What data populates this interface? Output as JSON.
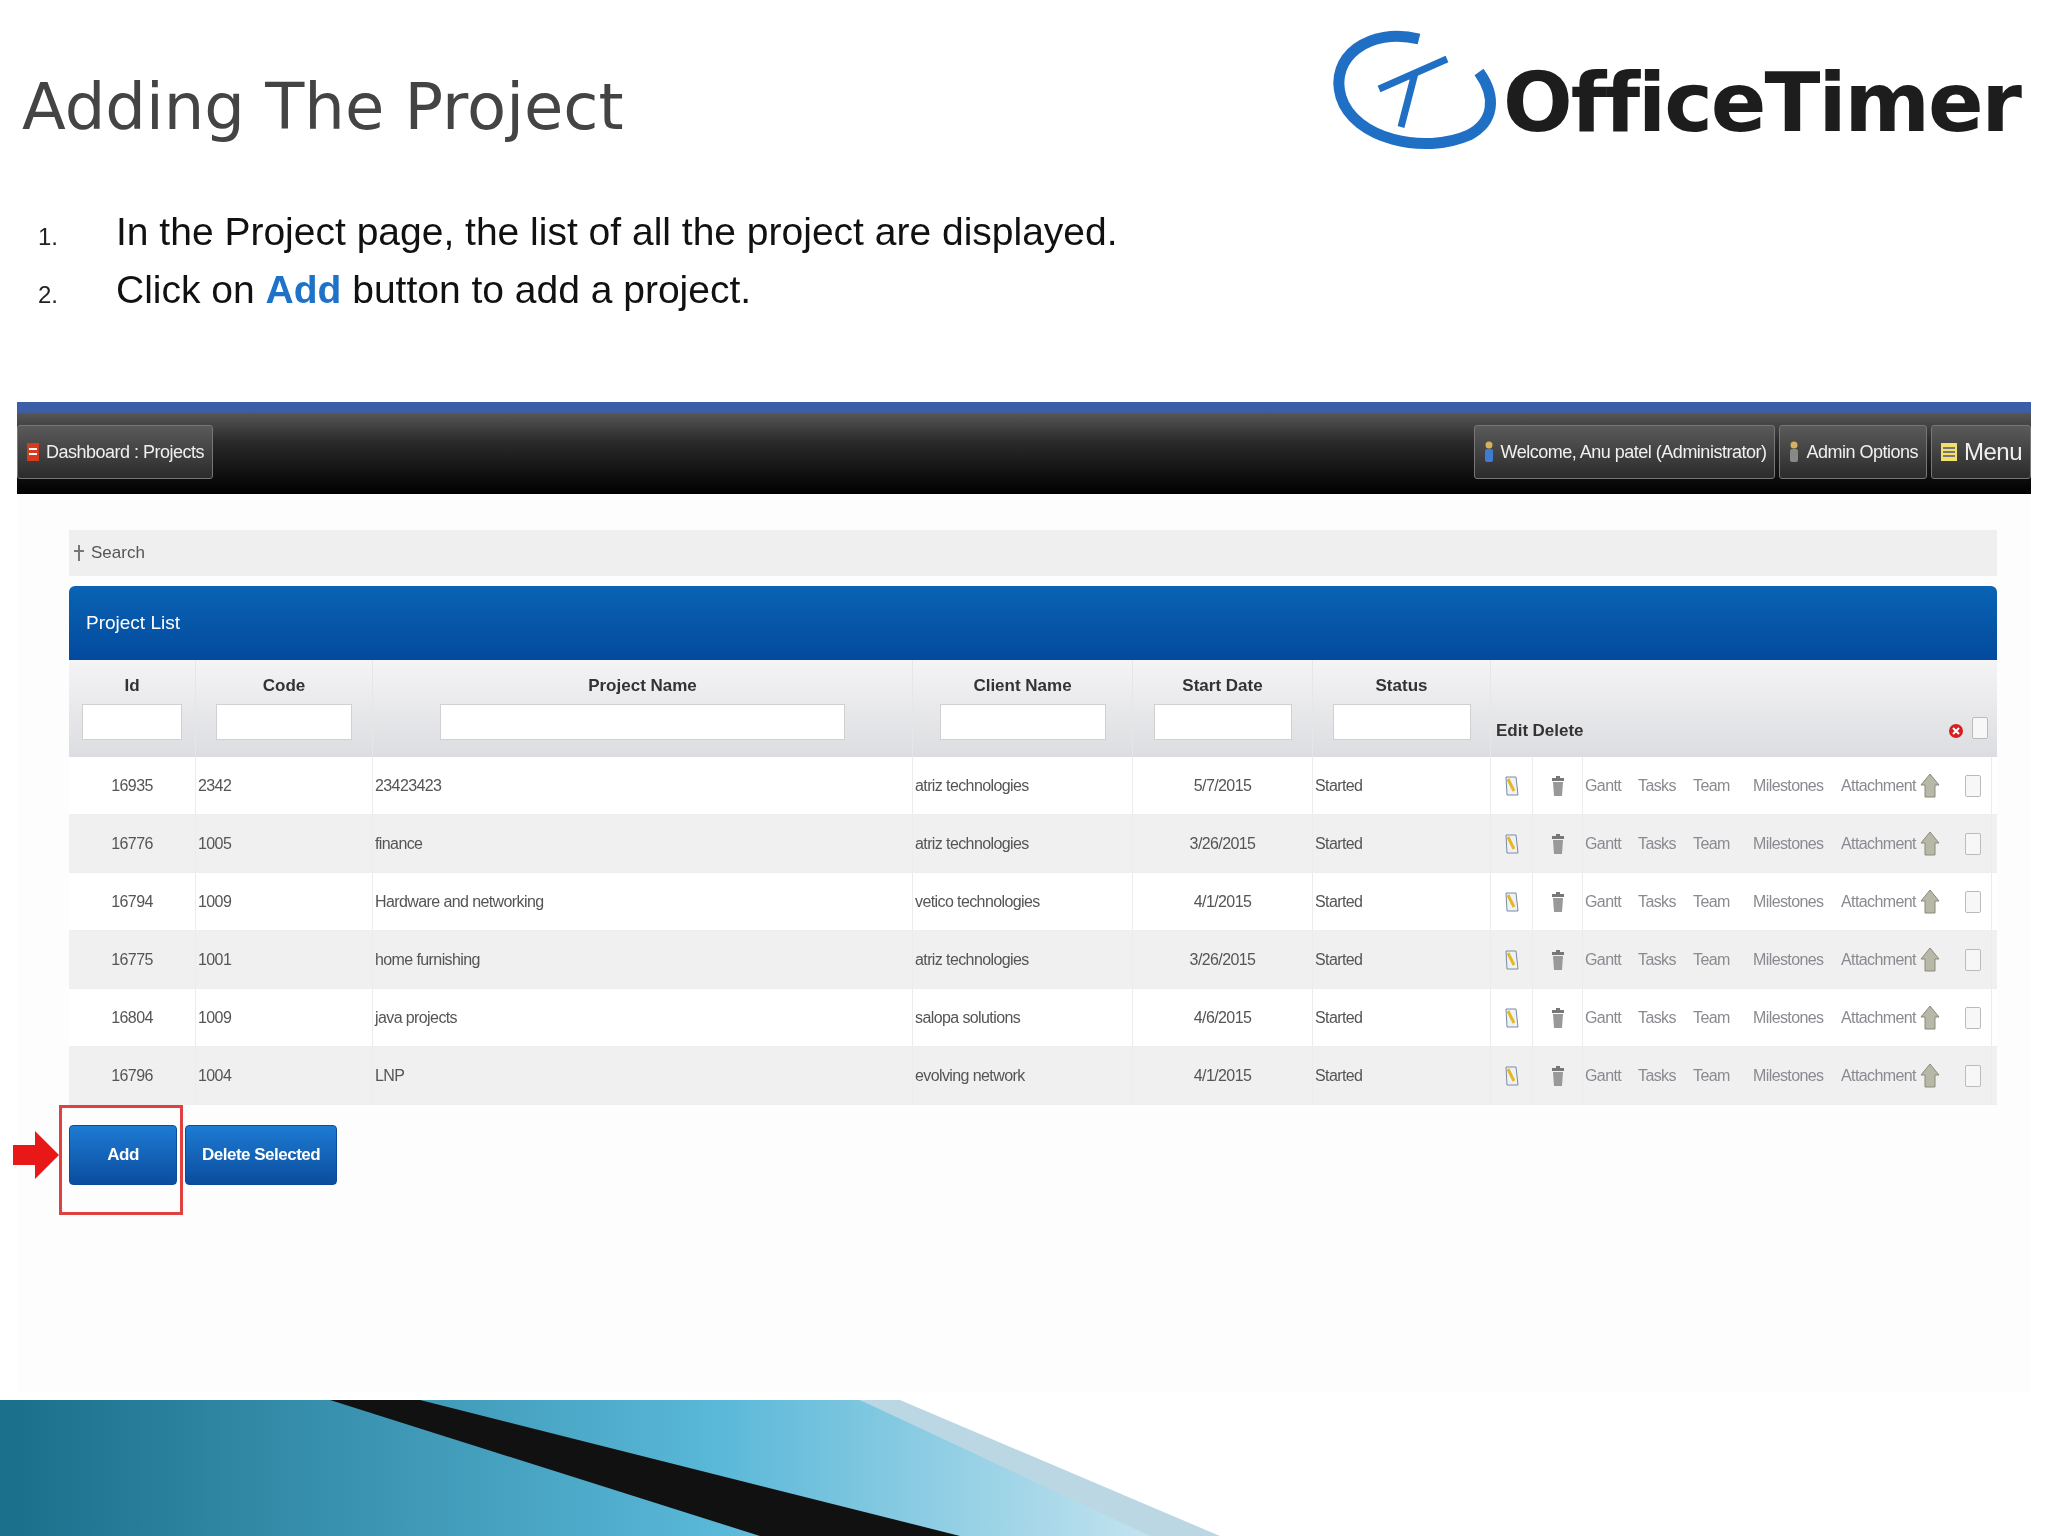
{
  "slide": {
    "title": "Adding The Project",
    "logo_text": "OfficeTimer"
  },
  "instructions": [
    {
      "number": "1.",
      "text": "In the Project page, the list of all the project are displayed."
    },
    {
      "number": "2.",
      "text": "Click on **Add** button to add a project."
    }
  ],
  "app": {
    "breadcrumb": "Dashboard : Projects",
    "welcome": "Welcome, Anu patel (Administrator)",
    "admin_options": "Admin Options",
    "menu": "Menu",
    "search_toggle": "Search",
    "panel_title": "Project List",
    "columns": [
      {
        "label": "Id",
        "kind": "filter"
      },
      {
        "label": "Code",
        "kind": "filter"
      },
      {
        "label": "Project Name",
        "kind": "filter"
      },
      {
        "label": "Client Name",
        "kind": "filter"
      },
      {
        "label": "Start Date",
        "kind": "filter"
      },
      {
        "label": "Status",
        "kind": "filter"
      },
      {
        "label": "Edit",
        "kind": "action"
      },
      {
        "label": "Delete",
        "kind": "action"
      }
    ],
    "select_all_checked": false,
    "rows": [
      {
        "id": "16935",
        "code": "2342",
        "project_name": "23423423",
        "client_name": "atriz technologies",
        "start_date": "5/7/2015",
        "status": "Started",
        "actions": [
          "Gantt",
          "Tasks",
          "Team",
          "Milestones",
          "Attachment"
        ],
        "checked": false
      },
      {
        "id": "16776",
        "code": "1005",
        "project_name": "finance",
        "client_name": "atriz technologies",
        "start_date": "3/26/2015",
        "status": "Started",
        "actions": [
          "Gantt",
          "Tasks",
          "Team",
          "Milestones",
          "Attachment"
        ],
        "checked": false
      },
      {
        "id": "16794",
        "code": "1009",
        "project_name": "Hardware and networking",
        "client_name": "vetico technologies",
        "start_date": "4/1/2015",
        "status": "Started",
        "actions": [
          "Gantt",
          "Tasks",
          "Team",
          "Milestones",
          "Attachment"
        ],
        "checked": false
      },
      {
        "id": "16775",
        "code": "1001",
        "project_name": "home furnishing",
        "client_name": "atriz technologies",
        "start_date": "3/26/2015",
        "status": "Started",
        "actions": [
          "Gantt",
          "Tasks",
          "Team",
          "Milestones",
          "Attachment"
        ],
        "checked": false
      },
      {
        "id": "16804",
        "code": "1009",
        "project_name": "java projects",
        "client_name": "salopa solutions",
        "start_date": "4/6/2015",
        "status": "Started",
        "actions": [
          "Gantt",
          "Tasks",
          "Team",
          "Milestones",
          "Attachment"
        ],
        "checked": false
      },
      {
        "id": "16796",
        "code": "1004",
        "project_name": "LNP",
        "client_name": "evolving network",
        "start_date": "4/1/2015",
        "status": "Started",
        "actions": [
          "Gantt",
          "Tasks",
          "Team",
          "Milestones",
          "Attachment"
        ],
        "checked": false
      }
    ],
    "buttons": [
      {
        "label": "Add",
        "highlighted": true
      },
      {
        "label": "Delete Selected",
        "highlighted": false
      }
    ]
  }
}
